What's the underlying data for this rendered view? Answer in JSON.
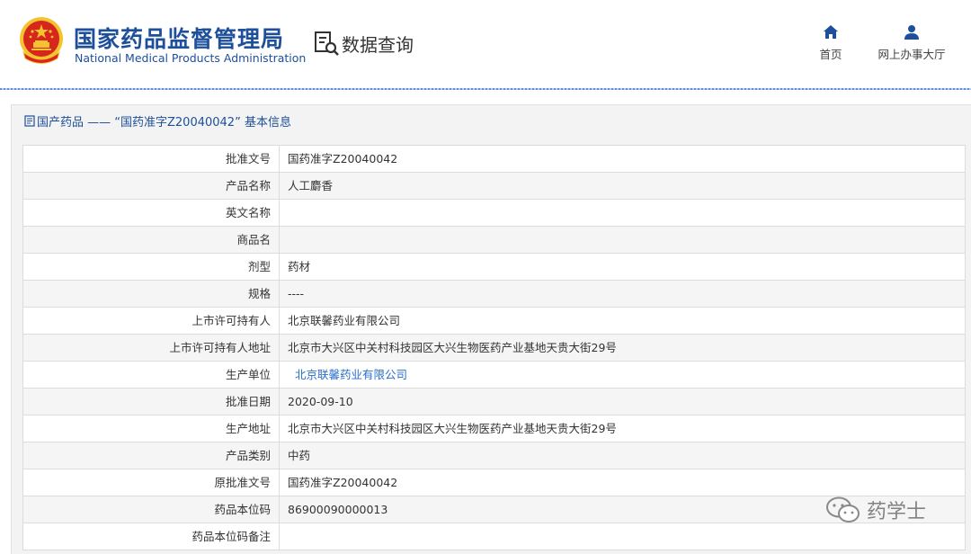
{
  "header": {
    "org_name_cn": "国家药品监督管理局",
    "org_name_en": "National Medical Products Administration",
    "section_title": "数据查询",
    "nav": [
      {
        "label": "首页",
        "icon": "home-icon"
      },
      {
        "label": "网上办事大厅",
        "icon": "user-icon"
      }
    ]
  },
  "panel": {
    "title": "国产药品 ——  “国药准字Z20040042”  基本信息"
  },
  "detail_rows": [
    {
      "label": "批准文号",
      "value": "国药准字Z20040042"
    },
    {
      "label": "产品名称",
      "value": "人工麝香"
    },
    {
      "label": "英文名称",
      "value": ""
    },
    {
      "label": "商品名",
      "value": ""
    },
    {
      "label": "剂型",
      "value": "药材"
    },
    {
      "label": "规格",
      "value": "----"
    },
    {
      "label": "上市许可持有人",
      "value": "北京联馨药业有限公司"
    },
    {
      "label": "上市许可持有人地址",
      "value": "北京市大兴区中关村科技园区大兴生物医药产业基地天贵大街29号"
    },
    {
      "label": "生产单位",
      "value": "北京联馨药业有限公司",
      "link": true
    },
    {
      "label": "批准日期",
      "value": "2020-09-10"
    },
    {
      "label": "生产地址",
      "value": "北京市大兴区中关村科技园区大兴生物医药产业基地天贵大街29号"
    },
    {
      "label": "产品类别",
      "value": "中药"
    },
    {
      "label": "原批准文号",
      "value": "国药准字Z20040042"
    },
    {
      "label": "药品本位码",
      "value": "86900090000013"
    },
    {
      "label": "药品本位码备注",
      "value": ""
    }
  ],
  "watermark": {
    "text": "药学士"
  },
  "colors": {
    "brand_blue": "#1d4f9a",
    "link_blue": "#2a6fc9",
    "emblem_red": "#d7261c",
    "emblem_gold": "#f4c430"
  }
}
